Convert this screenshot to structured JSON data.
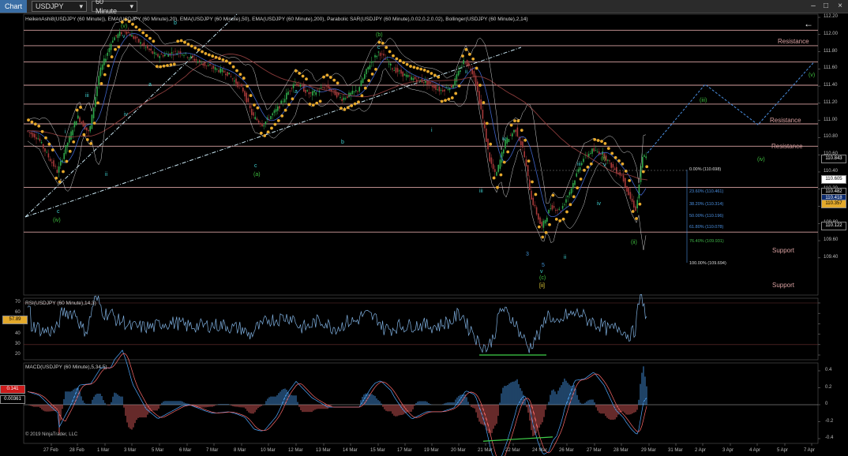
{
  "toolbar": {
    "title": "Chart",
    "instrument": "USDJPY",
    "period": "60 Minute",
    "minimize": "–",
    "maximize": "□",
    "close": "×"
  },
  "price_panel": {
    "indicators_label": "HeikenAshi8(USDJPY (60 Minute)), EMA(USDJPY (60 Minute),20), EMA(USDJPY (60 Minute),50), EMA(USDJPY (60 Minute),200), Parabolic SAR(USDJPY (60 Minute),0.02,0.2,0.02), Bollinger(USDJPY (60 Minute),2,14)",
    "y_ticks": [
      "112.20",
      "112.00",
      "111.80",
      "111.60",
      "111.40",
      "111.20",
      "111.00",
      "110.80",
      "110.60",
      "110.40",
      "110.20",
      "110.00",
      "109.80",
      "109.60",
      "109.40"
    ],
    "resistance_labels": [
      "Resistance",
      "Resistance",
      "Resistance"
    ],
    "support_labels": [
      "Support",
      "Support"
    ],
    "price_boxes": [
      {
        "text": "110.843",
        "bg": "#000000",
        "fg": "#ffffff"
      },
      {
        "text": "110.605",
        "bg": "#ffffff",
        "fg": "#000000"
      },
      {
        "text": "110.482",
        "bg": "#000000",
        "fg": "#ffffff"
      },
      {
        "text": "110.418",
        "bg": "#0b2a6e",
        "fg": "#ffffff"
      },
      {
        "text": "110.357",
        "bg": "#e3a92b",
        "fg": "#000000"
      },
      {
        "text": "110.122",
        "bg": "#000000",
        "fg": "#ffffff"
      }
    ],
    "fib_levels": [
      {
        "text": "0.00% (110.698)",
        "color": "#dcdcdc"
      },
      {
        "text": "23.60% (110.461)",
        "color": "#4a8fe0"
      },
      {
        "text": "38.20% (110.314)",
        "color": "#4a8fe0"
      },
      {
        "text": "50.00% (110.196)",
        "color": "#4a8fe0"
      },
      {
        "text": "61.80% (110.078)",
        "color": "#4a8fe0"
      },
      {
        "text": "76.40% (109.931)",
        "color": "#3fb548"
      },
      {
        "text": "100.00% (109.694)",
        "color": "#dcdcdc"
      }
    ],
    "waves": [
      {
        "t": "(v)",
        "c": "#3fbf3f"
      },
      {
        "t": "v",
        "c": "#3fd0d0"
      },
      {
        "t": "b",
        "c": "#3fd0d0"
      },
      {
        "t": "iii",
        "c": "#3fd0d0"
      },
      {
        "t": "iv",
        "c": "#3fd0d0"
      },
      {
        "t": "i",
        "c": "#3fd0d0"
      },
      {
        "t": "ii",
        "c": "#3fd0d0"
      },
      {
        "t": "a",
        "c": "#3fd0d0"
      },
      {
        "t": "c",
        "c": "#3fd0d0"
      },
      {
        "t": "(iv)",
        "c": "#3fbf3f"
      },
      {
        "t": "c",
        "c": "#3fd0d0"
      },
      {
        "t": "(a)",
        "c": "#3fbf3f"
      },
      {
        "t": "a",
        "c": "#3fd0d0"
      },
      {
        "t": "b",
        "c": "#3fd0d0"
      },
      {
        "t": "(b)",
        "c": "#3fbf3f"
      },
      {
        "t": "c",
        "c": "#3fd0d0"
      },
      {
        "t": "i",
        "c": "#3fd0d0"
      },
      {
        "t": "ii",
        "c": "#3fd0d0"
      },
      {
        "t": "iii",
        "c": "#3fd0d0"
      },
      {
        "t": "iv",
        "c": "#3fd0d0"
      },
      {
        "t": "3",
        "c": "#3f8fd0"
      },
      {
        "t": "5",
        "c": "#3f8fd0"
      },
      {
        "t": "v",
        "c": "#3fd0d0"
      },
      {
        "t": "(c)",
        "c": "#3fbf3f"
      },
      {
        "t": "[ii]",
        "c": "#e8d23a"
      },
      {
        "t": "iii",
        "c": "#3fd0d0"
      },
      {
        "t": "(i)",
        "c": "#3fbf3f"
      },
      {
        "t": "v",
        "c": "#3fd0d0"
      },
      {
        "t": "iv",
        "c": "#3fd0d0"
      },
      {
        "t": "ii",
        "c": "#3fd0d0"
      },
      {
        "t": "(ii)",
        "c": "#3fbf3f"
      },
      {
        "t": "(iii)",
        "c": "#3fbf3f"
      },
      {
        "t": "(iv)",
        "c": "#3fbf3f"
      },
      {
        "t": "(v)",
        "c": "#3fbf3f"
      }
    ]
  },
  "rsi_panel": {
    "label": "RSI(USDJPY (60 Minute),14,3)",
    "y_ticks": [
      "70",
      "60",
      "50",
      "40",
      "30",
      "20"
    ],
    "value_box": "57.89"
  },
  "macd_panel": {
    "label": "MACD(USDJPY (60 Minute),5,34,5)",
    "y_ticks": [
      "0.4",
      "0.2",
      "0",
      "-0.2",
      "-0.4"
    ],
    "value_boxes": [
      "0.141",
      "0.00361"
    ]
  },
  "x_axis": {
    "labels": [
      "27 Feb",
      "28 Feb",
      "1 Mar",
      "3 Mar",
      "5 Mar",
      "6 Mar",
      "7 Mar",
      "8 Mar",
      "10 Mar",
      "12 Mar",
      "13 Mar",
      "14 Mar",
      "15 Mar",
      "17 Mar",
      "19 Mar",
      "20 Mar",
      "21 Mar",
      "22 Mar",
      "24 Mar",
      "26 Mar",
      "27 Mar",
      "28 Mar",
      "29 Mar",
      "31 Mar",
      "2 Apr",
      "3 Apr",
      "4 Apr",
      "5 Apr",
      "7 Apr"
    ]
  },
  "copyright": "© 2019 NinjaTrader, LLC",
  "colors": {
    "candle_up": "#2fa84a",
    "candle_down": "#a83a3a",
    "sar_dot": "#e7a92c",
    "ema20": "#3f64c8",
    "ema200": "#8a3b3b",
    "bollinger": "#cfcfcf",
    "channel": "#c9e6f2",
    "projection": "#4a8fe0",
    "sr_line": "#d6a0a0",
    "divergence": "#3fd04a"
  }
}
